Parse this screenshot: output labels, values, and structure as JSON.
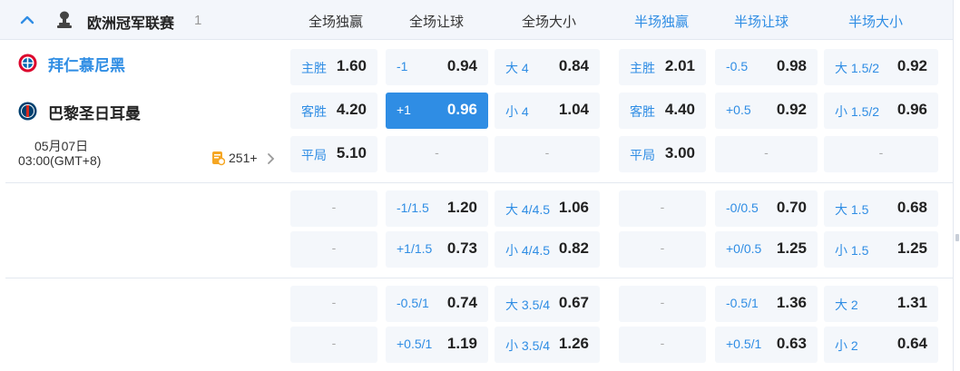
{
  "league": {
    "name": "欧洲冠军联赛",
    "match_count": "1"
  },
  "columns": [
    "全场独赢",
    "全场让球",
    "全场大小",
    "半场独赢",
    "半场让球",
    "半场大小"
  ],
  "match": {
    "home_team": "拜仁慕尼黑",
    "away_team": "巴黎圣日耳曼",
    "date": "05月07日",
    "time": "03:00(GMT+8)",
    "more_markets": "251+"
  },
  "colors": {
    "accent": "#2f8de4",
    "card_bg": "#f4f7fb",
    "header_bg": "#f3f6fb"
  },
  "odds": [
    [
      {
        "lbl": "主胜",
        "val": "1.60"
      },
      {
        "lbl": "-1",
        "val": "0.94"
      },
      {
        "lbl": "大 4",
        "val": "0.84"
      },
      {
        "lbl": "主胜",
        "val": "2.01"
      },
      {
        "lbl": "-0.5",
        "val": "0.98"
      },
      {
        "lbl": "大 1.5/2",
        "val": "0.92"
      }
    ],
    [
      {
        "lbl": "客胜",
        "val": "4.20"
      },
      {
        "lbl": "+1",
        "val": "0.96",
        "active": true
      },
      {
        "lbl": "小 4",
        "val": "1.04"
      },
      {
        "lbl": "客胜",
        "val": "4.40"
      },
      {
        "lbl": "+0.5",
        "val": "0.92"
      },
      {
        "lbl": "小 1.5/2",
        "val": "0.96"
      }
    ],
    [
      {
        "lbl": "平局",
        "val": "5.10"
      },
      {
        "dash": "-"
      },
      {
        "dash": "-"
      },
      {
        "lbl": "平局",
        "val": "3.00"
      },
      {
        "dash": "-"
      },
      {
        "dash": "-"
      }
    ],
    [
      {
        "dash": "-"
      },
      {
        "lbl": "-1/1.5",
        "val": "1.20"
      },
      {
        "lbl": "大 4/4.5",
        "val": "1.06"
      },
      {
        "dash": "-"
      },
      {
        "lbl": "-0/0.5",
        "val": "0.70"
      },
      {
        "lbl": "大 1.5",
        "val": "0.68"
      }
    ],
    [
      {
        "dash": "-"
      },
      {
        "lbl": "+1/1.5",
        "val": "0.73"
      },
      {
        "lbl": "小 4/4.5",
        "val": "0.82"
      },
      {
        "dash": "-"
      },
      {
        "lbl": "+0/0.5",
        "val": "1.25"
      },
      {
        "lbl": "小 1.5",
        "val": "1.25"
      }
    ],
    [
      {
        "dash": "-"
      },
      {
        "lbl": "-0.5/1",
        "val": "0.74"
      },
      {
        "lbl": "大 3.5/4",
        "val": "0.67"
      },
      {
        "dash": "-"
      },
      {
        "lbl": "-0.5/1",
        "val": "1.36"
      },
      {
        "lbl": "大 2",
        "val": "1.31"
      }
    ],
    [
      {
        "dash": "-"
      },
      {
        "lbl": "+0.5/1",
        "val": "1.19"
      },
      {
        "lbl": "小 3.5/4",
        "val": "1.26"
      },
      {
        "dash": "-"
      },
      {
        "lbl": "+0.5/1",
        "val": "0.63"
      },
      {
        "lbl": "小 2",
        "val": "0.64"
      }
    ]
  ]
}
